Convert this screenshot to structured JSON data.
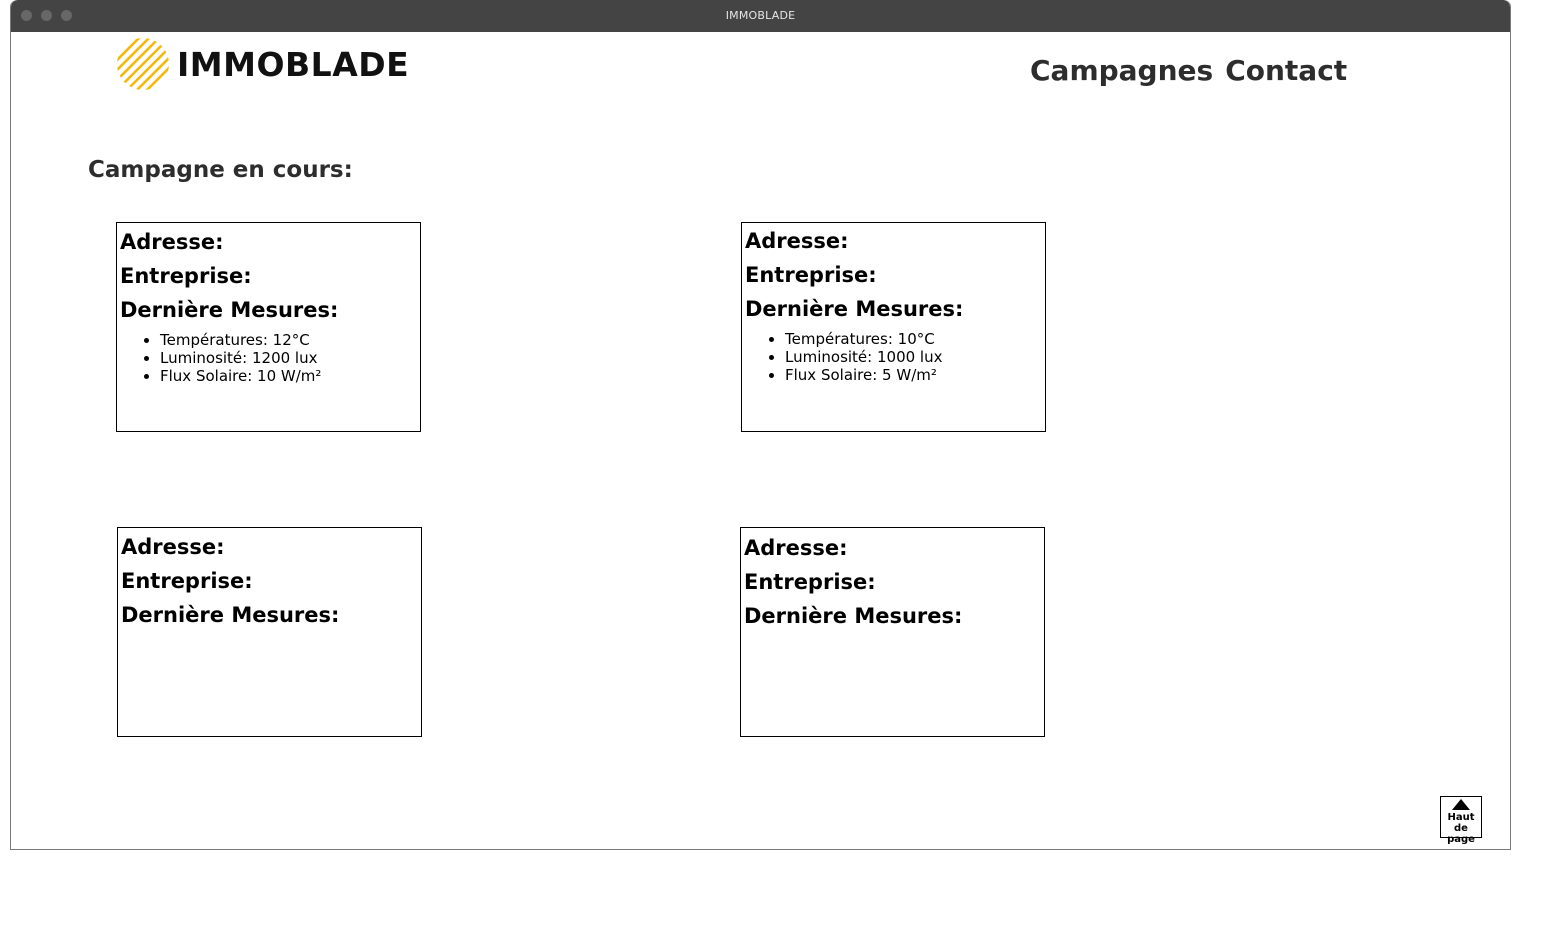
{
  "window": {
    "title": "IMMOBLADE"
  },
  "header": {
    "logo_text": "IMMOBLADE",
    "nav": [
      {
        "label": "Campagnes"
      },
      {
        "label": "Contact"
      }
    ]
  },
  "main": {
    "section_title": "Campagne en cours:",
    "cards": [
      {
        "address_label": "Adresse:",
        "company_label": "Entreprise:",
        "measures_label": "Dernière Mesures:",
        "measures": [
          "Températures: 12°C",
          "Luminosité: 1200 lux",
          "Flux Solaire: 10 W/m²"
        ]
      },
      {
        "address_label": "Adresse:",
        "company_label": "Entreprise:",
        "measures_label": "Dernière Mesures:",
        "measures": [
          "Températures: 10°C",
          "Luminosité: 1000 lux",
          "Flux Solaire: 5 W/m²"
        ]
      },
      {
        "address_label": "Adresse:",
        "company_label": "Entreprise:",
        "measures_label": "Dernière Mesures:",
        "measures": []
      },
      {
        "address_label": "Adresse:",
        "company_label": "Entreprise:",
        "measures_label": "Dernière Mesures:",
        "measures": []
      }
    ]
  },
  "footer": {
    "back_to_top_label": "Haut de page"
  },
  "colors": {
    "titlebar": "#444444",
    "text_dark": "#2d2d2d",
    "logo_accent": "#f2b90f"
  },
  "icons": {
    "logo_mark": "diagonal-stripes-logo-icon",
    "back_to_top": "triangle-up-icon"
  }
}
